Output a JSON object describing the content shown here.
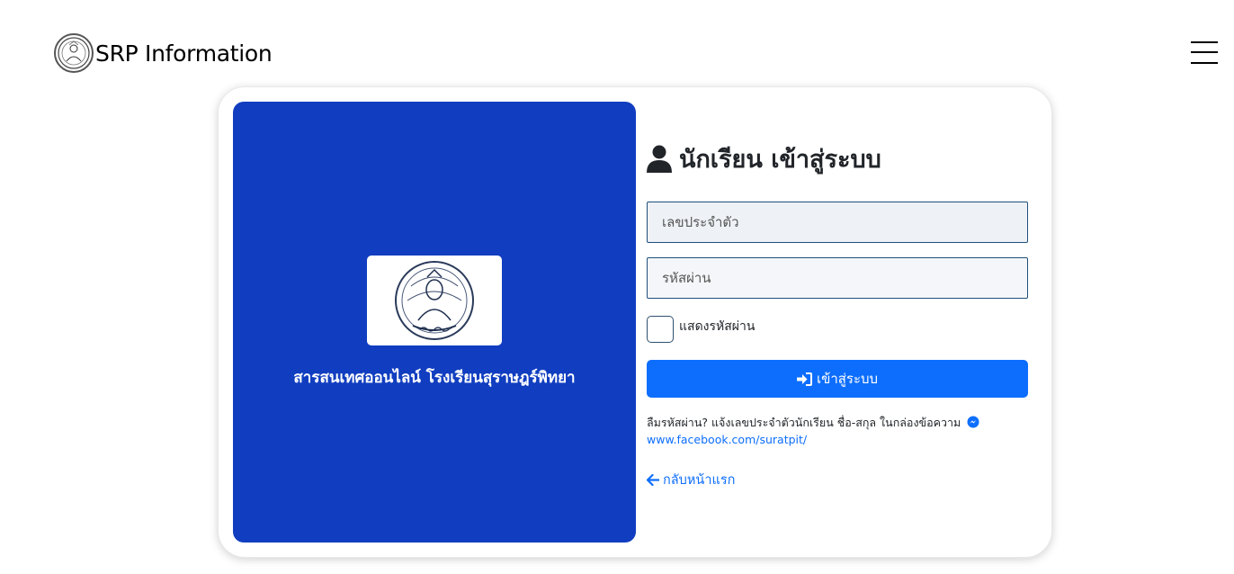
{
  "navbar": {
    "brand_text": "SRP Information"
  },
  "panel": {
    "school_name": "สารสนเทศออนไลน์ โรงเรียนสุราษฎร์พิทยา"
  },
  "form": {
    "title": "นักเรียน เข้าสู่ระบบ",
    "student_id_placeholder": "เลขประจำตัว",
    "student_id_value": "",
    "password_placeholder": "รหัสผ่าน",
    "password_value": "",
    "show_password_label": "แสดงรหัสผ่าน",
    "login_label": "เข้าสู่ระบบ",
    "forgot_text": "ลืมรหัสผ่าน? แจ้งเลขประจำตัวนักเรียน ชื่อ-สกุล ในกล่องข้อความ",
    "facebook_link": "www.facebook.com/suratpit/",
    "back_label": "กลับหน้าแรก"
  },
  "icons": {
    "brand": "school-seal-icon",
    "menu": "hamburger-menu-icon",
    "title": "user-icon",
    "login": "sign-in-icon",
    "messenger": "messenger-icon",
    "back": "arrow-left-icon"
  },
  "colors": {
    "panel_blue": "#113ec0",
    "primary": "#0d6efd"
  }
}
